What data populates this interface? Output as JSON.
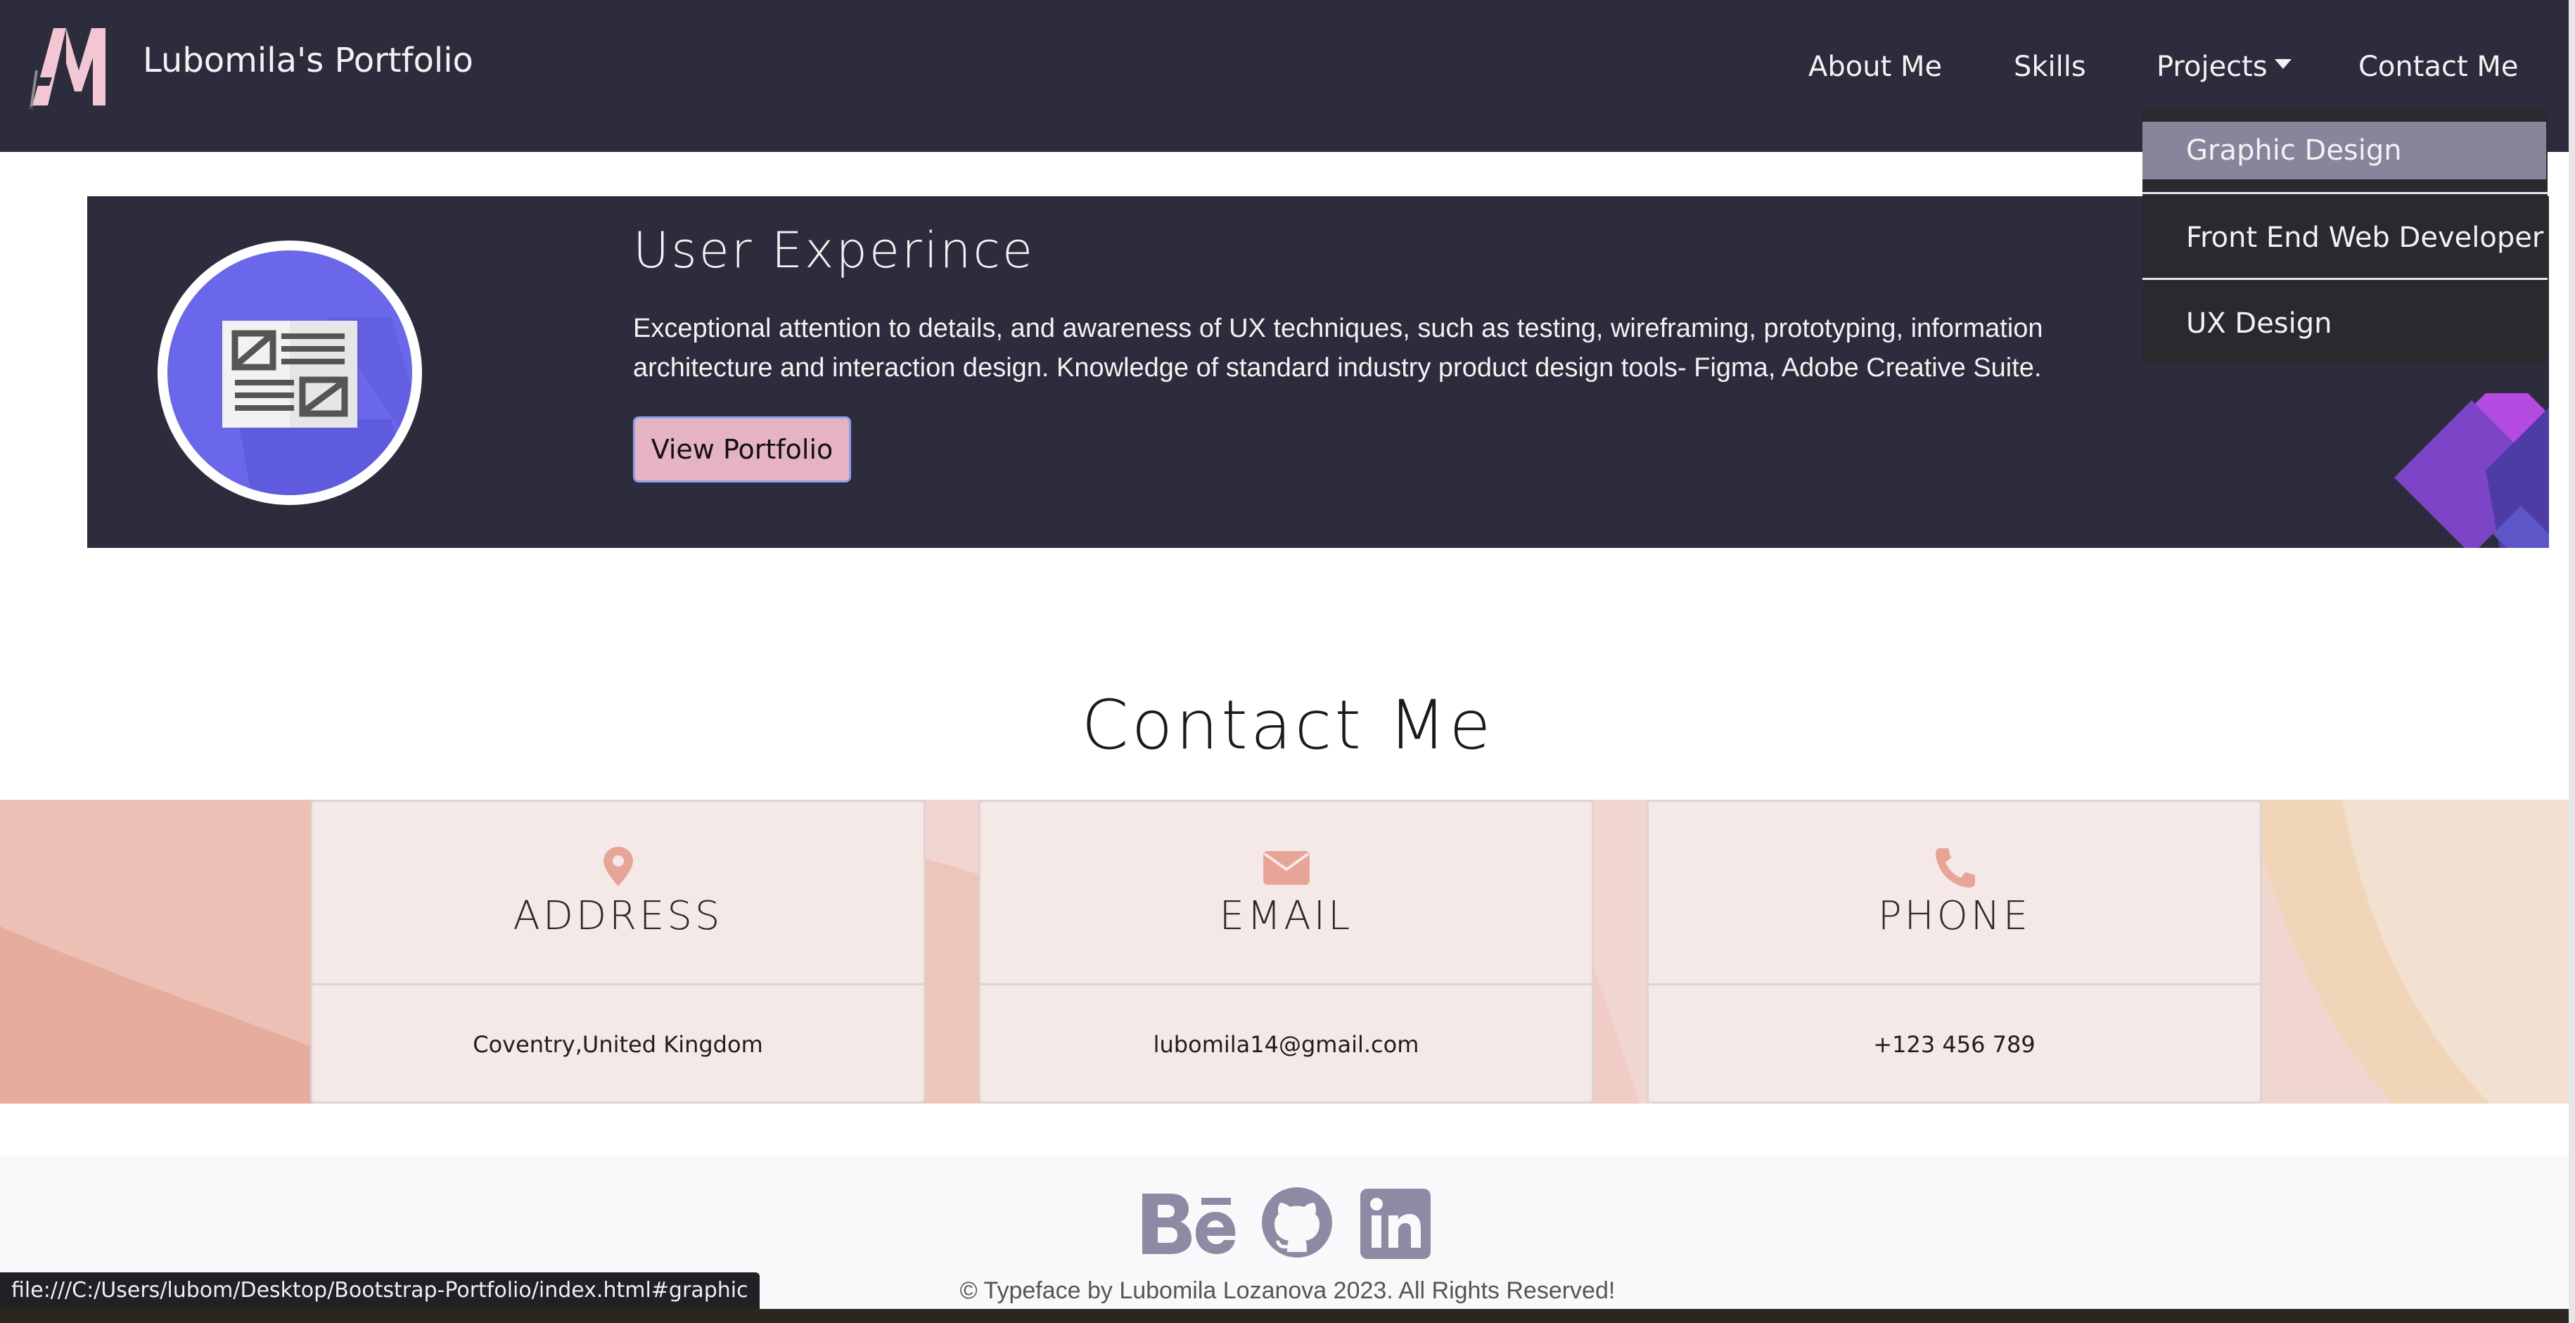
{
  "navbar": {
    "brand": "Lubomila's Portfolio",
    "logo_icon": "lm-monogram-logo",
    "links": [
      "About Me",
      "Skills",
      "Projects",
      "Contact Me"
    ]
  },
  "dropdown": {
    "items": [
      "Graphic Design",
      "Front End Web Developer",
      "UX Design"
    ],
    "active_index": 0
  },
  "ux_section": {
    "title": "User Experince",
    "description": "Exceptional attention to details, and awareness of UX techniques, such as testing, wireframing, prototyping, information architecture and interaction design. Knowledge of standard industry product design tools- Figma, Adobe Creative Suite.",
    "button_label": "View Portfolio",
    "icon": "layout-wireframe-icon"
  },
  "contact": {
    "title": "Contact Me",
    "cards": [
      {
        "icon": "map-pin-icon",
        "heading": "ADDRESS",
        "value": "Coventry,United Kingdom"
      },
      {
        "icon": "envelope-icon",
        "heading": "EMAIL",
        "value": "lubomila14@gmail.com"
      },
      {
        "icon": "phone-icon",
        "heading": "PHONE",
        "value": "+123 456 789"
      }
    ]
  },
  "footer": {
    "social_icons": [
      "behance-icon",
      "github-icon",
      "linkedin-icon"
    ],
    "copyright": "© Typeface by Lubomila Lozanova 2023. All Rights Reserved!"
  },
  "statusbar": {
    "url": "file:///C:/Users/lubom/Desktop/Bootstrap-Portfolio/index.html#graphic"
  },
  "colors": {
    "navbar_bg": "#2d2c3c",
    "accent_pink": "#e6b3c3",
    "icon_purple": "#6a67eb",
    "dropdown_active": "#89849c",
    "contact_icon": "#e8a597",
    "social_icon": "#8f8aa3"
  }
}
